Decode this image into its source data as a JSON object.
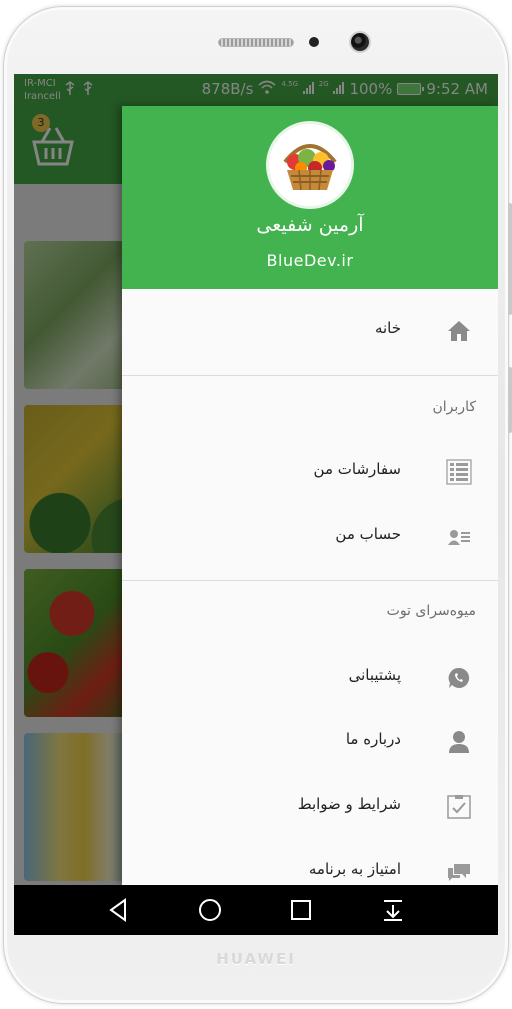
{
  "status_bar": {
    "carrier_1": "IR-MCI",
    "carrier_2": "Irancell",
    "speed": "878B/s",
    "net_1": "4.5G",
    "net_2": "2G",
    "battery": "100%",
    "time": "9:52 AM"
  },
  "background_app": {
    "cart_badge": "3"
  },
  "drawer": {
    "header": {
      "user_name": "آرمین شفیعی",
      "site": "BlueDev.ir"
    },
    "items": {
      "home": "خانه",
      "users_section": "کاربران",
      "orders": "سفارشات من",
      "account": "حساب من",
      "shop_section": "میوه‌سرای توت",
      "support": "پشتیبانی",
      "about": "درباره ما",
      "terms": "شرایط و ضوابط",
      "rate": "امتیاز به برنامه"
    },
    "icons": {
      "home": "home-icon",
      "orders": "list-icon",
      "account": "contact-card-icon",
      "support": "whatsapp-icon",
      "about": "person-icon",
      "terms": "checklist-icon",
      "rate": "chat-icon"
    }
  },
  "device": {
    "brand": "HUAWEI"
  },
  "colors": {
    "primary": "#43a843",
    "drawer_header": "#43b34f",
    "icon": "#8a8a8a"
  }
}
